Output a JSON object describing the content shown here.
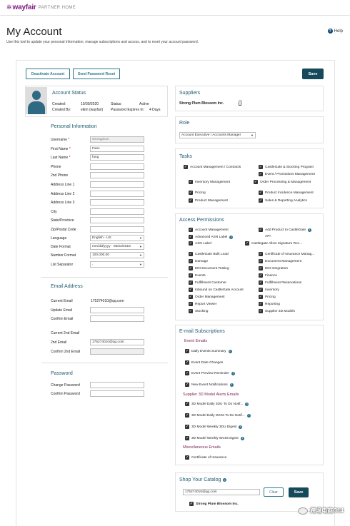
{
  "brand": {
    "logo": "wayfair",
    "sub": "PARTNER HOME"
  },
  "page": {
    "title": "My Account",
    "help": "Help",
    "description": "Use this tool to update your personal information, manage subscriptions and access, and to reset your account password."
  },
  "actions": {
    "deactivate": "Deactivate Account",
    "reset": "Send Password Reset",
    "save": "Save"
  },
  "status": {
    "heading": "Account Status",
    "created_label": "Created:",
    "created_value": "10/30/2020",
    "status_label": "Status:",
    "status_value": "Active",
    "createdby_label": "Created By:",
    "createdby_value": "ekim (wayfair)",
    "expires_label": "Password Expires In:",
    "expires_value": "4 Days"
  },
  "personal": {
    "heading": "Personal Information",
    "username_label": "Username",
    "username_value": "strongplum",
    "first_label": "First Name",
    "first_value": "Fanx",
    "last_label": "Last Name",
    "last_value": "fung",
    "phone_label": "Phone",
    "phone2_label": "2nd Phone",
    "addr1_label": "Address Line 1",
    "addr2_label": "Address Line 2",
    "addr3_label": "Address Line 3",
    "city_label": "City",
    "state_label": "State/Province",
    "zip_label": "Zip/Postal Code",
    "lang_label": "Language",
    "lang_value": "English - US",
    "date_label": "Date Format",
    "date_value": "mm/dd/yyyy - 05/22/2016",
    "num_label": "Number Format",
    "num_value": "100,000.00",
    "list_label": "List Separator",
    "list_value": ","
  },
  "email": {
    "heading": "Email Address",
    "current_label": "Current Email",
    "current_value": "175274010@qq.com",
    "update_label": "Update Email",
    "confirm_label": "Confirm Email",
    "cur2_label": "Current 2nd Email",
    "second_label": "2nd Email",
    "second_value": "175274010@qq.com",
    "confirm2_label": "Confirm 2nd Email"
  },
  "password": {
    "heading": "Password",
    "change_label": "Change Password",
    "confirm_label": "Confirm Password"
  },
  "suppliers": {
    "heading": "Suppliers",
    "name": "Strong Plum Blossom Inc."
  },
  "role": {
    "heading": "Role",
    "value": "Account Executive / Accounts Manager"
  },
  "tasks": {
    "heading": "Tasks",
    "items": [
      "Account Management / Contracts",
      "CastleGate & Stocking Program",
      "Event / Promotions Management",
      "Inventory Management",
      "Order Processing & Management",
      "Pricing",
      "Product Incidence Management",
      "Product Management",
      "Sales & Reporting Analytics"
    ]
  },
  "access": {
    "heading": "Access Permissions",
    "items": [
      "Account Management",
      "Add Product to CastleGate",
      "Advanced ASN Label",
      "API",
      "ASN Label",
      "Castlegate Allow Signature Rec...",
      "CastleGate Bulk Load",
      "Certificate of Insurance Manag...",
      "Damage",
      "Document Management",
      "EDI Document Testing",
      "EDI Integration",
      "Events",
      "Finance",
      "Fulfillment Customer",
      "Fulfillment Reservations",
      "Inbound on CastleGate Account",
      "Inventory",
      "Order Management",
      "Pricing",
      "Report Viewer",
      "Reporting",
      "Stocking",
      "Supplier 3D Models"
    ]
  },
  "subs": {
    "heading": "E-mail Subscriptions",
    "event_heading": "Event Emails",
    "event_items": [
      "Daily Events Summary",
      "Event Date Changes",
      "Event Preview Reminder",
      "New Event Notifications"
    ],
    "model_heading": "Supplier 3D Model Alerts Emails",
    "model_items": [
      "3D Model Daily 3DU To Do Notif...",
      "3D Model Daily WCM To Do Notif...",
      "3D Model Weekly 3DU Digest",
      "3D Model Weekly WCM Digest"
    ],
    "misc_heading": "Miscellaneous Emails",
    "misc_items": [
      "Certificate of Insurance"
    ]
  },
  "catalog": {
    "heading": "Shop Your Catalog",
    "input_value": "175274010@qq.com",
    "clear": "Clear",
    "save": "Save",
    "supplier": "Strong Plum Blossom Inc."
  },
  "watermark": "跨境电商C14",
  "colors": {
    "brand": "#7f187f",
    "accent": "#164a5a",
    "heading": "#1e5a6e",
    "subheading": "#7b1f4e"
  }
}
